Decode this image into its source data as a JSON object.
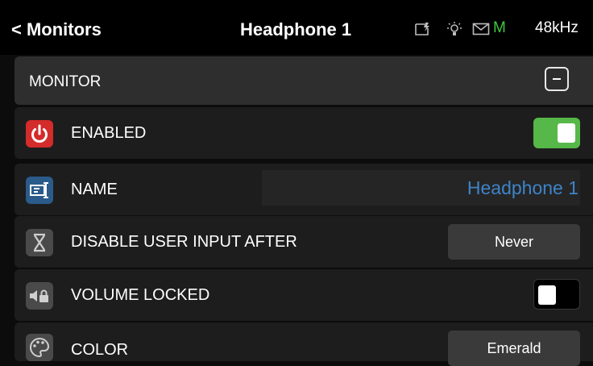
{
  "header": {
    "back_label": "< Monitors",
    "title": "Headphone 1",
    "status": {
      "m_label": "M",
      "sample_rate": "48kHz",
      "m_color": "#3ec93e"
    }
  },
  "section": {
    "title": "MONITOR"
  },
  "rows": {
    "enabled": {
      "label": "ENABLED",
      "icon": "power-icon",
      "value": true
    },
    "name": {
      "label": "NAME",
      "icon": "rename-icon",
      "value": "Headphone 1"
    },
    "disable_input": {
      "label": "DISABLE USER INPUT AFTER",
      "icon": "hourglass-icon",
      "value": "Never"
    },
    "volume_locked": {
      "label": "VOLUME LOCKED",
      "icon": "volume-lock-icon",
      "value": false
    },
    "color": {
      "label": "COLOR",
      "icon": "palette-icon",
      "value": "Emerald"
    }
  },
  "colors": {
    "accent_green": "#56b848",
    "name_blue": "#3d84c9",
    "power_red": "#d42b2b"
  }
}
